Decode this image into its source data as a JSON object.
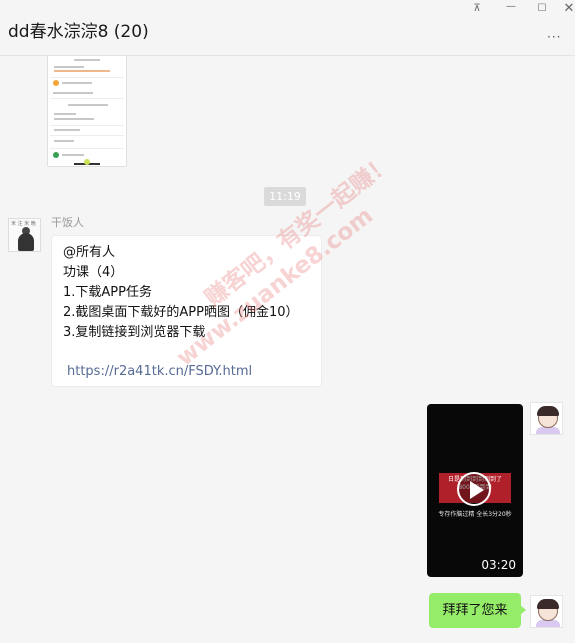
{
  "window": {
    "title": "dd春水淙淙8 (20)",
    "buttons": {
      "pin": "⊼",
      "minimize": "—",
      "maximize": "☐",
      "close": "✕"
    },
    "more_label": "···"
  },
  "chat": {
    "timestamp": "11:19",
    "incoming": {
      "sender": "干饭人",
      "lines": [
        "@所有人",
        "功课（4）",
        "1.下载APP任务",
        "2.截图桌面下载好的APP晒图（佣金10）",
        "3.复制链接到浏览器下载"
      ],
      "link": "https://r2a41tk.cn/FSDY.html"
    },
    "outgoing_video": {
      "duration": "03:20",
      "banner_text": "日是到到到到到到了 8000到到到",
      "caption_text": "专存作脑过精 全长3分20秒"
    },
    "outgoing_text": "拜拜了您来"
  },
  "watermark": {
    "line1": "赚客吧，有奖一起赚！",
    "line2": "www.zuanke8.com"
  }
}
